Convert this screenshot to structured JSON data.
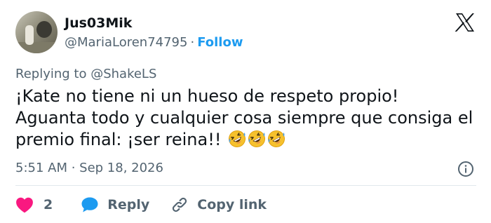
{
  "author": {
    "name": "Jus03Mik",
    "handle": "@MariaLoren74795",
    "separator": "·",
    "follow_label": "Follow"
  },
  "reply_context": "Replying to @ShakeLS",
  "tweet": {
    "lines": [
      "¡Kate no tiene ni un hueso de respeto propio!",
      "Aguanta todo y cualquier cosa siempre que consiga el",
      "premio final: ¡ser reina!!"
    ],
    "emoji": "rolling-on-floor-laughing",
    "emoji_count": 3
  },
  "meta": {
    "timestamp": "5:51 AM · Sep 18, 2026"
  },
  "actions": {
    "like_count": "2",
    "reply_label": "Reply",
    "copy_link_label": "Copy link"
  },
  "colors": {
    "text": "#0f1419",
    "secondary": "#536471",
    "accent": "#1d9bf0",
    "like": "#f91880",
    "reply_bubble": "#1d9bf0",
    "divider": "#e1e8ed"
  },
  "icons": [
    "x-logo-icon",
    "info-icon",
    "heart-icon",
    "speech-bubble-icon",
    "link-icon",
    "rolling-laughing-emoji"
  ]
}
